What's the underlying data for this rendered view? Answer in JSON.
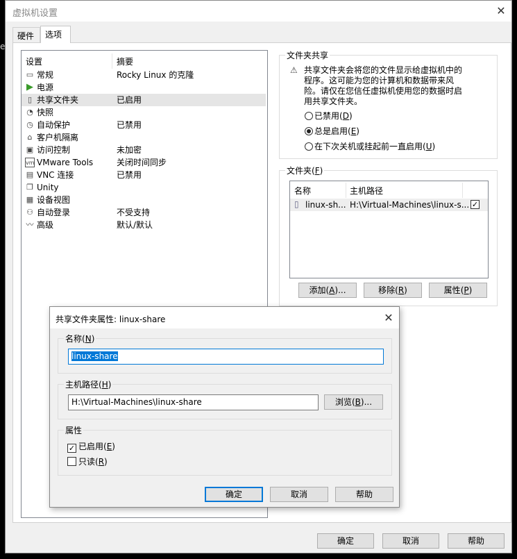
{
  "window": {
    "title": "虚拟机设置",
    "close": "✕"
  },
  "bg_fragment": "e",
  "tabs": [
    {
      "label": "硬件"
    },
    {
      "label": "选项"
    }
  ],
  "settings": {
    "col_setting": "设置",
    "col_summary": "摘要",
    "items": [
      {
        "label": "常规",
        "summary": "Rocky Linux 的克隆",
        "icon": "monitor-icon"
      },
      {
        "label": "电源",
        "summary": "",
        "icon": "play-icon"
      },
      {
        "label": "共享文件夹",
        "summary": "已启用",
        "icon": "shared-folder-icon"
      },
      {
        "label": "快照",
        "summary": "",
        "icon": "snapshot-icon"
      },
      {
        "label": "自动保护",
        "summary": "已禁用",
        "icon": "clock-icon"
      },
      {
        "label": "客户机隔离",
        "summary": "",
        "icon": "lock-icon"
      },
      {
        "label": "访问控制",
        "summary": "未加密",
        "icon": "access-control-icon"
      },
      {
        "label": "VMware Tools",
        "summary": "关闭时间同步",
        "icon": "vm-icon"
      },
      {
        "label": "VNC 连接",
        "summary": "已禁用",
        "icon": "vnc-icon"
      },
      {
        "label": "Unity",
        "summary": "",
        "icon": "unity-icon"
      },
      {
        "label": "设备视图",
        "summary": "",
        "icon": "device-view-icon"
      },
      {
        "label": "自动登录",
        "summary": "不受支持",
        "icon": "users-icon"
      },
      {
        "label": "高级",
        "summary": "默认/默认",
        "icon": "advanced-icon"
      }
    ]
  },
  "sharing": {
    "title": "文件夹共享",
    "warning": "共享文件夹会将您的文件显示给虚拟机中的程序。这可能为您的计算机和数据带来风险。请仅在您信任虚拟机使用您的数据时启用共享文件夹。",
    "options": [
      {
        "label": "已禁用",
        "key": "D",
        "checked": false
      },
      {
        "label": "总是启用",
        "key": "E",
        "checked": true
      },
      {
        "label": "在下次关机或挂起前一直启用",
        "key": "U",
        "checked": false
      }
    ]
  },
  "folders": {
    "title": "文件夹",
    "key": "F",
    "col_name": "名称",
    "col_path": "主机路径",
    "rows": [
      {
        "name": "linux-sh...",
        "path": "H:\\Virtual-Machines\\linux-s...",
        "enabled": true
      }
    ],
    "add": "添加",
    "add_key": "A",
    "remove": "移除",
    "remove_key": "R",
    "props": "属性",
    "props_key": "P"
  },
  "footer": {
    "ok": "确定",
    "cancel": "取消",
    "help": "帮助"
  },
  "dialog": {
    "title": "共享文件夹属性: linux-share",
    "name_label": "名称",
    "name_key": "N",
    "name_value": "linux-share",
    "path_label": "主机路径",
    "path_key": "H",
    "path_value": "H:\\Virtual-Machines\\linux-share",
    "browse": "浏览",
    "browse_key": "B",
    "attr_label": "属性",
    "enabled": "已启用",
    "enabled_key": "E",
    "enabled_checked": true,
    "readonly": "只读",
    "readonly_key": "R",
    "readonly_checked": false,
    "ok": "确定",
    "cancel": "取消",
    "help": "帮助"
  }
}
